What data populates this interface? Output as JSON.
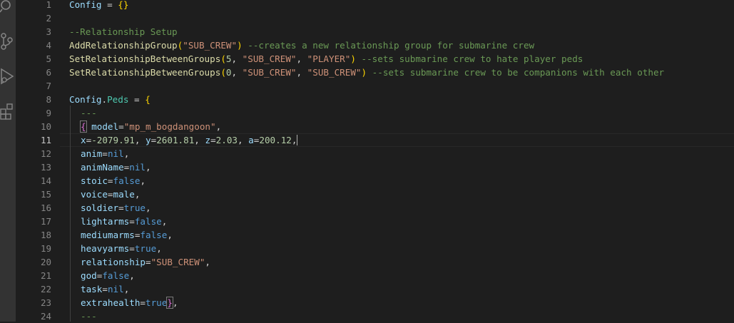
{
  "activity_bar": {
    "icons": [
      "search-icon",
      "source-control-icon",
      "run-debug-icon",
      "extensions-icon"
    ]
  },
  "editor": {
    "active_line": 11,
    "line_numbers": [
      "1",
      "2",
      "3",
      "4",
      "5",
      "6",
      "7",
      "8",
      "9",
      "10",
      "11",
      "12",
      "13",
      "14",
      "15",
      "16",
      "17",
      "18",
      "19",
      "20",
      "21",
      "22",
      "23",
      "24"
    ],
    "lines": {
      "l1": {
        "a": "Config",
        "b": " = ",
        "c": "{}"
      },
      "l3": {
        "a": "--Relationship Setup"
      },
      "l4": {
        "a": "AddRelationshipGroup",
        "b": "(",
        "c": "\"SUB_CREW\"",
        "d": ")",
        "e": " --creates a new relationship group for submarine crew"
      },
      "l5": {
        "a": "SetRelationshipBetweenGroups",
        "b": "(",
        "c": "5",
        "d": ", ",
        "e": "\"SUB_CREW\"",
        "f": ", ",
        "g": "\"PLAYER\"",
        "h": ")",
        "i": " --sets submarine crew to hate player peds"
      },
      "l6": {
        "a": "SetRelationshipBetweenGroups",
        "b": "(",
        "c": "0",
        "d": ", ",
        "e": "\"SUB_CREW\"",
        "f": ", ",
        "g": "\"SUB_CREW\"",
        "h": ")",
        "i": " --sets submarine crew to be companions with each other"
      },
      "l8": {
        "a": "Config",
        "b": ".",
        "c": "Peds",
        "d": " = ",
        "e": "{"
      },
      "l9": {
        "a": "---"
      },
      "l10": {
        "a": "{",
        "b": " model",
        "c": "=",
        "d": "\"mp_m_bogdangoon\"",
        "e": ","
      },
      "l11": {
        "a": "x",
        "b": "=",
        "c": "-2079.91",
        "d": ", ",
        "e": "y",
        "f": "=",
        "g": "2601.81",
        "h": ", ",
        "i": "z",
        "j": "=",
        "k": "2.03",
        "l": ", ",
        "m": "a",
        "n": "=",
        "o": "200.12",
        "p": ","
      },
      "l12": {
        "a": "anim",
        "b": "=",
        "c": "nil",
        "d": ","
      },
      "l13": {
        "a": "animName",
        "b": "=",
        "c": "nil",
        "d": ","
      },
      "l14": {
        "a": "stoic",
        "b": "=",
        "c": "false",
        "d": ","
      },
      "l15": {
        "a": "voice",
        "b": "=",
        "c": "male",
        "d": ","
      },
      "l16": {
        "a": "soldier",
        "b": "=",
        "c": "true",
        "d": ","
      },
      "l17": {
        "a": "lightarms",
        "b": "=",
        "c": "false",
        "d": ","
      },
      "l18": {
        "a": "mediumarms",
        "b": "=",
        "c": "false",
        "d": ","
      },
      "l19": {
        "a": "heavyarms",
        "b": "=",
        "c": "true",
        "d": ","
      },
      "l20": {
        "a": "relationship",
        "b": "=",
        "c": "\"SUB_CREW\"",
        "d": ","
      },
      "l21": {
        "a": "god",
        "b": "=",
        "c": "false",
        "d": ","
      },
      "l22": {
        "a": "task",
        "b": "=",
        "c": "nil",
        "d": ","
      },
      "l23": {
        "a": "extrahealth",
        "b": "=",
        "c": "true",
        "d": "}",
        "e": ","
      },
      "l24": {
        "a": "---"
      }
    }
  },
  "colors": {
    "background": "#1e1e1e",
    "function": "#dcdcaa",
    "variable": "#9cdcfe",
    "string": "#ce9178",
    "number": "#b5cea8",
    "comment": "#6a9955",
    "keyword": "#569cd6",
    "bracket": "#ffd700"
  }
}
